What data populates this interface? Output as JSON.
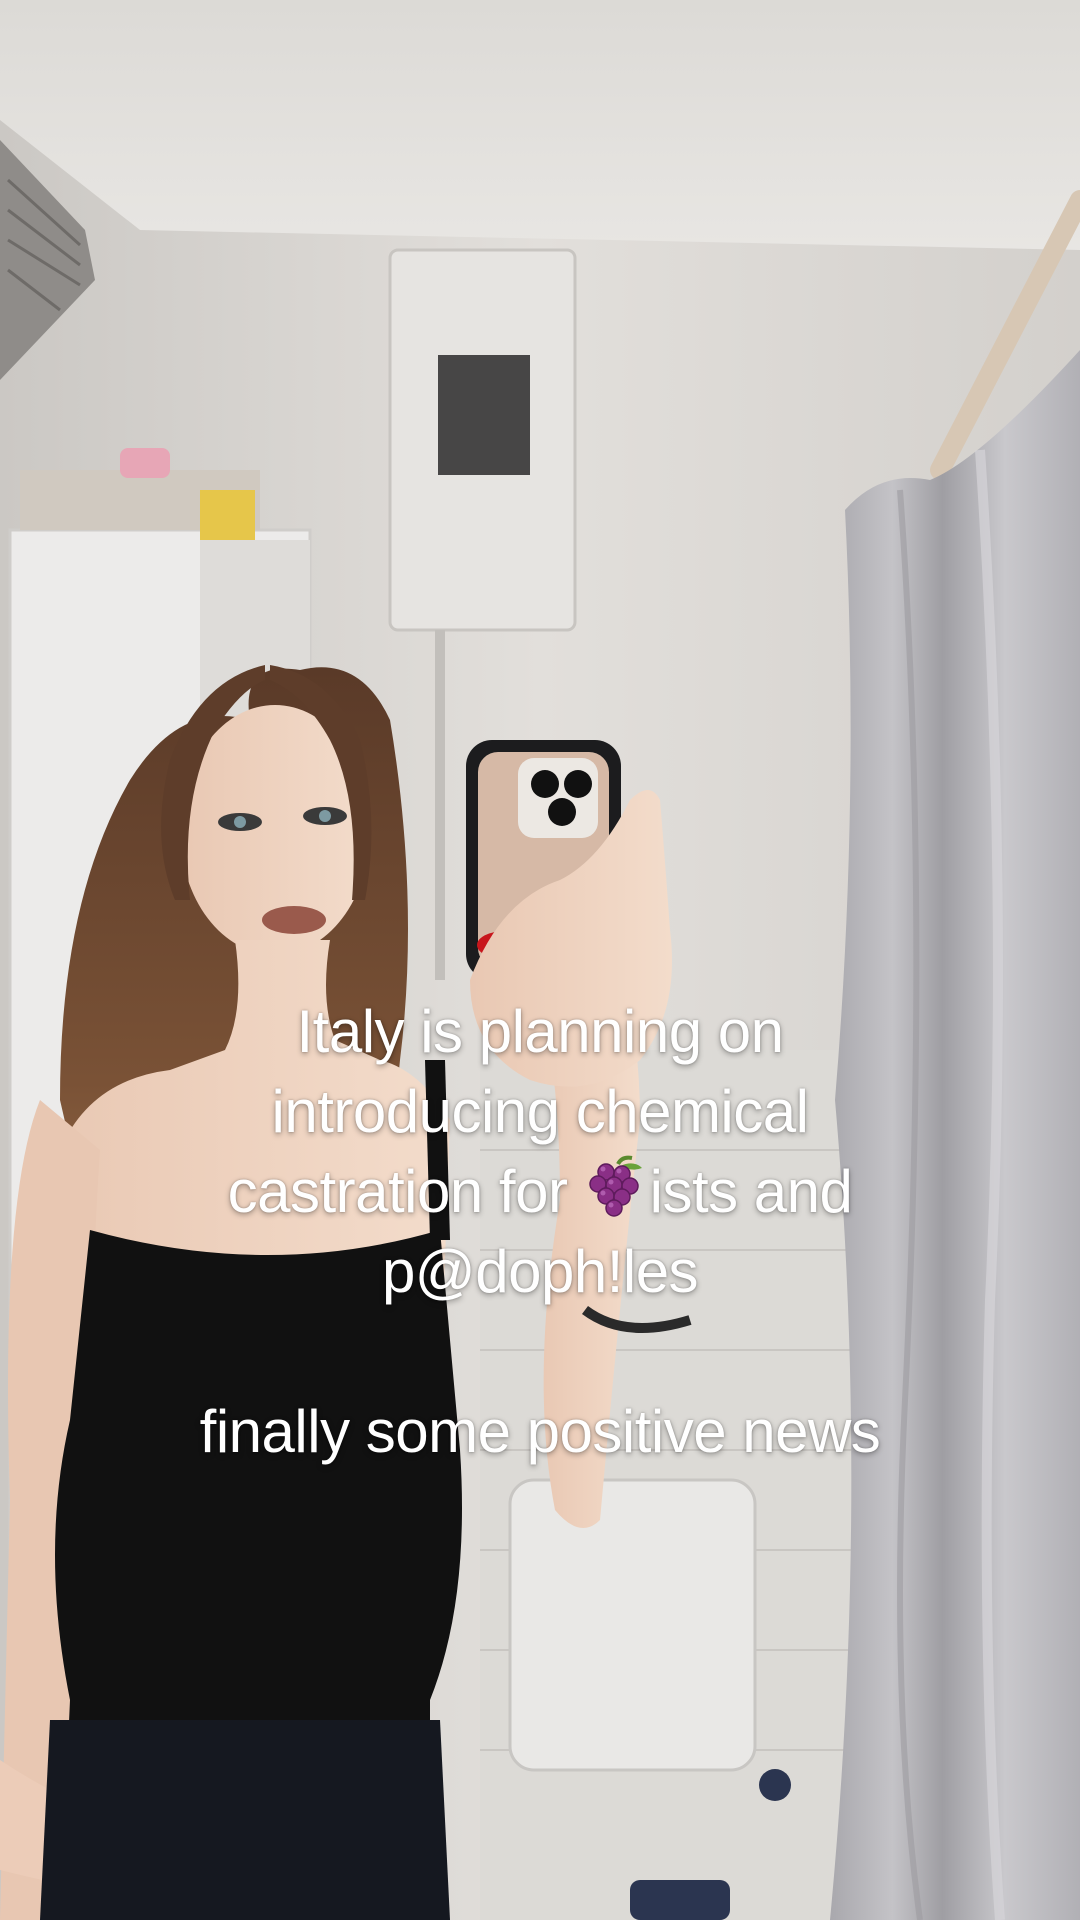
{
  "caption": {
    "line1": "Italy is planning on",
    "line2": "introducing chemical",
    "line3_before": "castration for ",
    "line3_emoji": "grapes-emoji",
    "line3_after": "ists and",
    "line4": "p@doph!les",
    "line5": "finally some positive news"
  },
  "colors": {
    "caption_text": "#ffffff",
    "wall": "#d9d6d2",
    "ceiling": "#e4e2df",
    "curtain": "#b4b3b8",
    "top_garment": "#111111",
    "hair": "#6b4630",
    "phone_case": "#1c1c1e"
  },
  "icons": {
    "emoji": "grapes-emoji"
  }
}
